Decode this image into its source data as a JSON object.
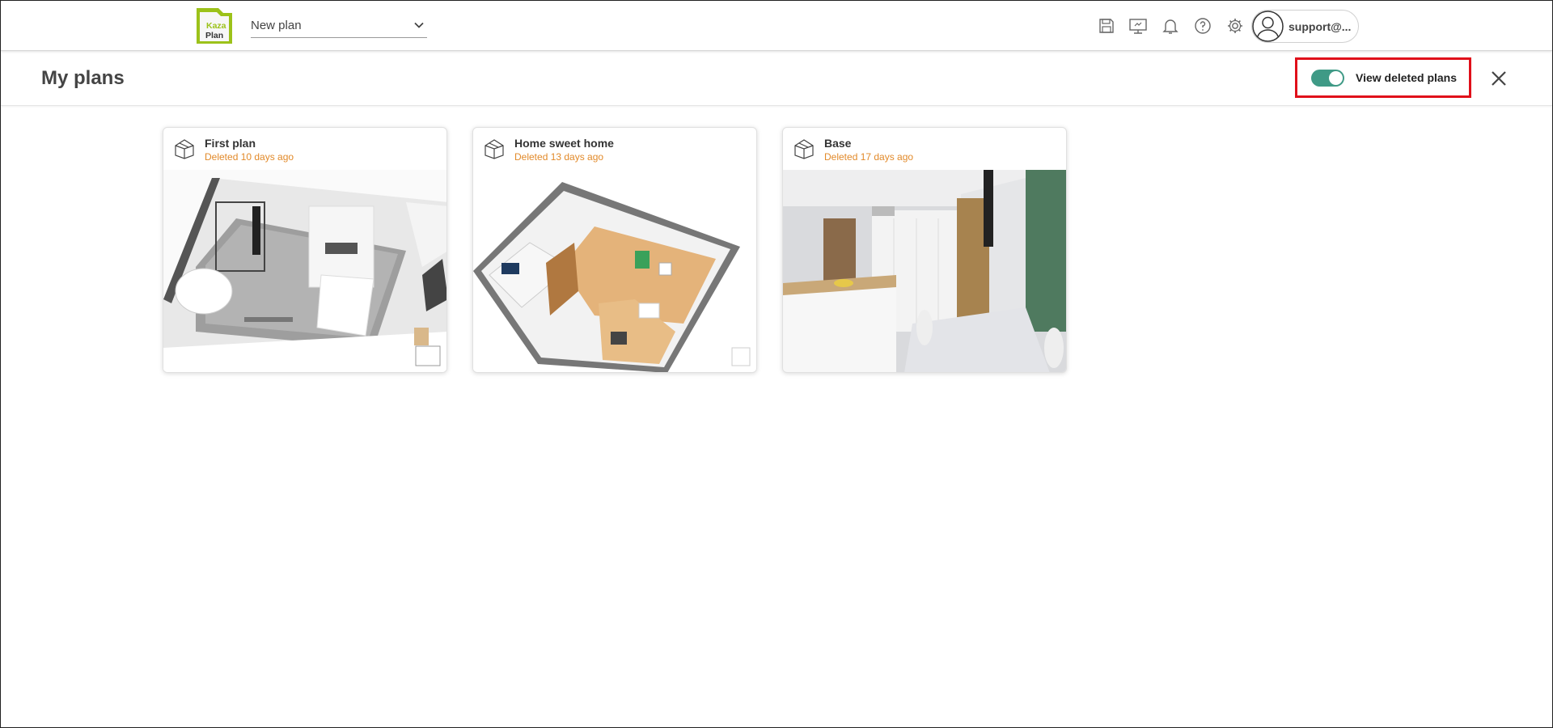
{
  "topbar": {
    "logo_text_line1": "Kaza",
    "logo_text_line2": "Plan",
    "plan_selector": "New plan",
    "icons": [
      "save-icon",
      "presentation-icon",
      "bell-icon",
      "help-icon",
      "settings-icon"
    ],
    "user_name": "support@..."
  },
  "page": {
    "title": "My plans",
    "toggle_label": "View deleted plans",
    "toggle_on": true
  },
  "plans": [
    {
      "name": "First plan",
      "deleted": "Deleted 10 days ago"
    },
    {
      "name": "Home sweet home",
      "deleted": "Deleted 13 days ago"
    },
    {
      "name": "Base",
      "deleted": "Deleted 17 days ago"
    }
  ],
  "colors": {
    "accent_toggle": "#3f9a86",
    "deleted_text": "#e28a2a",
    "highlight_box": "#e0101a",
    "logo_green": "#9cc21a"
  }
}
